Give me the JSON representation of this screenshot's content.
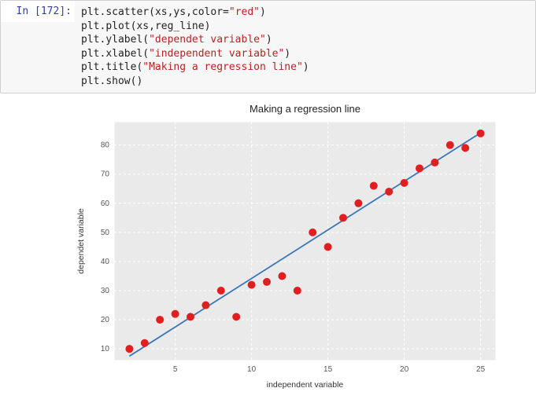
{
  "cell": {
    "prompt_prefix": "In [",
    "exec_count": "172",
    "prompt_suffix": "]:",
    "code_lines": [
      {
        "parts": [
          {
            "t": "plt",
            "c": "tok-call"
          },
          {
            "t": ".",
            "c": "tok-call"
          },
          {
            "t": "scatter",
            "c": "tok-attr"
          },
          {
            "t": "(",
            "c": "tok-paren"
          },
          {
            "t": "xs",
            "c": "tok-call"
          },
          {
            "t": ",",
            "c": "tok-comma"
          },
          {
            "t": "ys",
            "c": "tok-call"
          },
          {
            "t": ",",
            "c": "tok-comma"
          },
          {
            "t": "color",
            "c": "tok-call"
          },
          {
            "t": "=",
            "c": "tok-eq"
          },
          {
            "t": "\"red\"",
            "c": "tok-str"
          },
          {
            "t": ")",
            "c": "tok-paren"
          }
        ]
      },
      {
        "parts": [
          {
            "t": "plt",
            "c": "tok-call"
          },
          {
            "t": ".",
            "c": "tok-call"
          },
          {
            "t": "plot",
            "c": "tok-attr"
          },
          {
            "t": "(",
            "c": "tok-paren"
          },
          {
            "t": "xs",
            "c": "tok-call"
          },
          {
            "t": ",",
            "c": "tok-comma"
          },
          {
            "t": "reg_line",
            "c": "tok-call"
          },
          {
            "t": ")",
            "c": "tok-paren"
          }
        ]
      },
      {
        "parts": [
          {
            "t": "plt",
            "c": "tok-call"
          },
          {
            "t": ".",
            "c": "tok-call"
          },
          {
            "t": "ylabel",
            "c": "tok-attr"
          },
          {
            "t": "(",
            "c": "tok-paren"
          },
          {
            "t": "\"dependet variable\"",
            "c": "tok-str"
          },
          {
            "t": ")",
            "c": "tok-paren"
          }
        ]
      },
      {
        "parts": [
          {
            "t": "plt",
            "c": "tok-call"
          },
          {
            "t": ".",
            "c": "tok-call"
          },
          {
            "t": "xlabel",
            "c": "tok-attr"
          },
          {
            "t": "(",
            "c": "tok-paren"
          },
          {
            "t": "\"independent variable\"",
            "c": "tok-str"
          },
          {
            "t": ")",
            "c": "tok-paren"
          }
        ]
      },
      {
        "parts": [
          {
            "t": "plt",
            "c": "tok-call"
          },
          {
            "t": ".",
            "c": "tok-call"
          },
          {
            "t": "title",
            "c": "tok-attr"
          },
          {
            "t": "(",
            "c": "tok-paren"
          },
          {
            "t": "\"Making a regression line\"",
            "c": "tok-str"
          },
          {
            "t": ")",
            "c": "tok-paren"
          }
        ]
      },
      {
        "parts": [
          {
            "t": "plt",
            "c": "tok-call"
          },
          {
            "t": ".",
            "c": "tok-call"
          },
          {
            "t": "show",
            "c": "tok-attr"
          },
          {
            "t": "()",
            "c": "tok-paren"
          }
        ]
      }
    ]
  },
  "chart_data": {
    "type": "scatter",
    "title": "Making a regression line",
    "xlabel": "independent variable",
    "ylabel": "dependet variable",
    "xlim": [
      1,
      26
    ],
    "ylim": [
      6,
      88
    ],
    "xticks": [
      5,
      10,
      15,
      20,
      25
    ],
    "yticks": [
      10,
      20,
      30,
      40,
      50,
      60,
      70,
      80
    ],
    "scatter_color": "#e02020",
    "line_color": "#3a78b5",
    "x": [
      2,
      3,
      4,
      5,
      6,
      7,
      8,
      9,
      10,
      11,
      12,
      13,
      14,
      15,
      16,
      17,
      18,
      19,
      20,
      21,
      22,
      23,
      24,
      25
    ],
    "y": [
      10,
      12,
      20,
      22,
      21,
      25,
      30,
      21,
      32,
      33,
      35,
      30,
      50,
      45,
      55,
      60,
      66,
      64,
      67,
      72,
      74,
      80,
      79,
      84
    ],
    "reg_line": {
      "x1": 2,
      "y1": 7.5,
      "x2": 25,
      "y2": 84.2
    }
  },
  "colors": {
    "plot_bg": "#eaeaea",
    "grid": "#ffffff"
  }
}
